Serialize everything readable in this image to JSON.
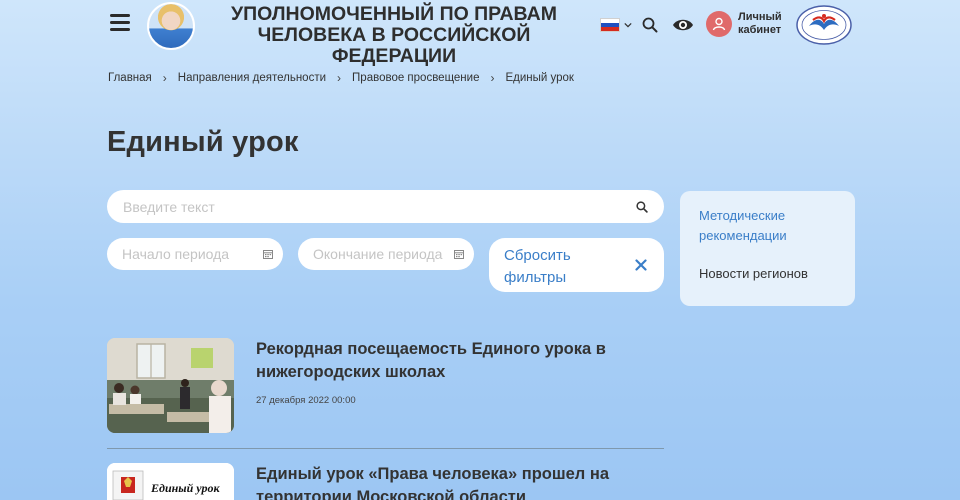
{
  "header": {
    "org_title": "Уполномоченный по правам человека в Российской Федерации",
    "cabinet_label": "Личный кабинет",
    "flag_colors": [
      "#ffffff",
      "#1f4fbf",
      "#d52b1e"
    ],
    "cabinet_icon_color": "#e06a6a"
  },
  "breadcrumb": [
    "Главная",
    "Направления деятельности",
    "Правовое просвещение",
    "Единый урок"
  ],
  "page": {
    "title": "Единый урок"
  },
  "filters": {
    "search_placeholder": "Введите текст",
    "start_placeholder": "Начало периода",
    "end_placeholder": "Окончание периода",
    "reset_label": "Сбросить фильтры"
  },
  "side_nav": {
    "items": [
      "Методические рекомендации",
      "Новости регионов"
    ]
  },
  "news": [
    {
      "title": "Рекордная посещаемость Единого урока в нижегородских школах",
      "date": "27 декабря 2022 00:00"
    },
    {
      "title": "Единый урок «Права человека» прошел на территории Московской области",
      "thumb_caption": "Единый урок"
    }
  ],
  "colors": {
    "accent": "#3a7ec8",
    "text": "#333333"
  }
}
